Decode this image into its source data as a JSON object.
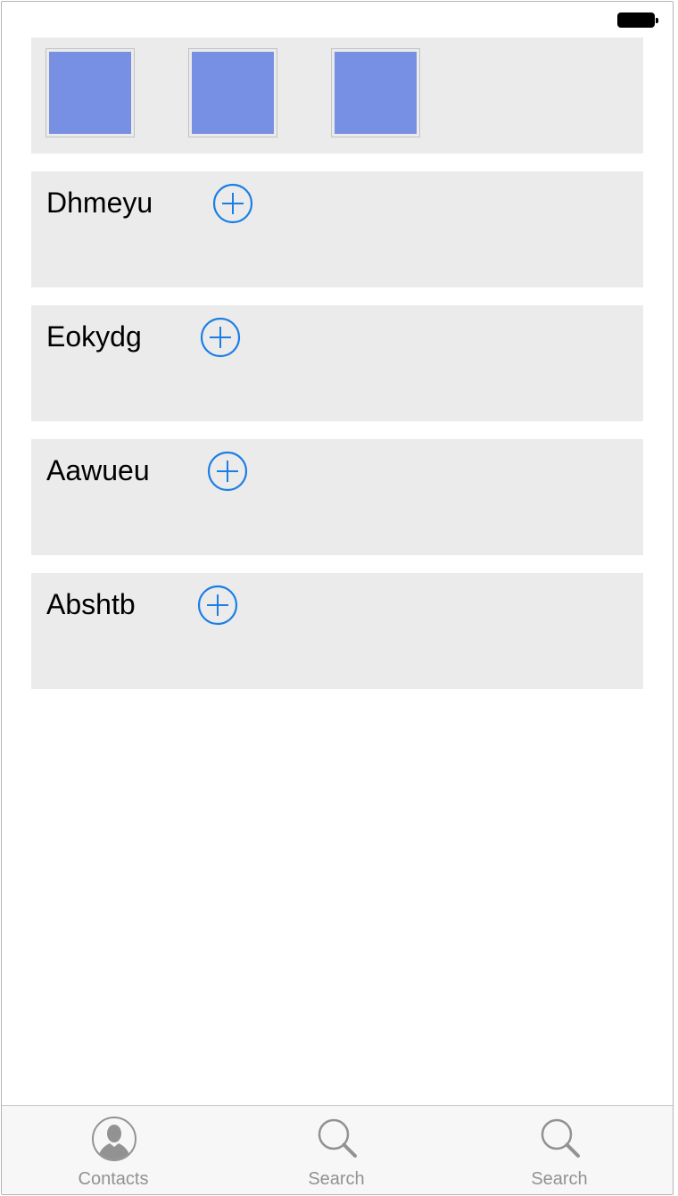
{
  "status_bar": {
    "battery_icon": "battery-full-icon"
  },
  "image_strip": {
    "thumbnails": [
      {
        "color": "#7890e3"
      },
      {
        "color": "#7890e3"
      },
      {
        "color": "#7890e3"
      }
    ]
  },
  "rows": [
    {
      "label": "Dhmeyu",
      "action_icon": "add-circle-icon"
    },
    {
      "label": "Eokydg",
      "action_icon": "add-circle-icon"
    },
    {
      "label": "Aawueu",
      "action_icon": "add-circle-icon"
    },
    {
      "label": "Abshtb",
      "action_icon": "add-circle-icon"
    }
  ],
  "tab_bar": {
    "tabs": [
      {
        "label": "Contacts",
        "icon": "person-icon"
      },
      {
        "label": "Search",
        "icon": "search-icon"
      },
      {
        "label": "Search",
        "icon": "search-icon"
      }
    ]
  },
  "colors": {
    "accent": "#1b7ee6",
    "panel_bg": "#ebebeb",
    "tab_inactive": "#929292",
    "thumbnail_fill": "#7890e3"
  }
}
